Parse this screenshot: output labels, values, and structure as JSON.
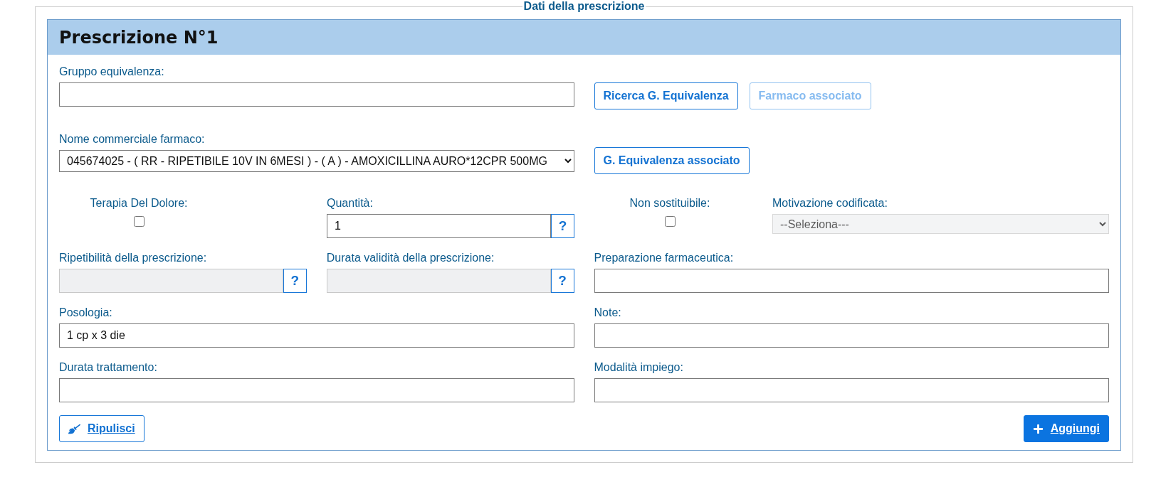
{
  "legend": "Dati della prescrizione",
  "panel_title": "Prescrizione N°1",
  "gruppo_equivalenza": {
    "label": "Gruppo equivalenza:",
    "disabled": false
  },
  "gruppo_buttons": [
    {
      "label": "Ricerca G. Equivalenza",
      "disabled": false
    },
    {
      "label": "Farmaco associato",
      "disabled": true
    }
  ],
  "nome_commerciale": {
    "label": "Nome commerciale farmaco:",
    "value": "045674025 - ( RR - RIPETIBILE 10V IN 6MESI ) - ( A ) - AMOXICILLINA AURO*12CPR 500MG",
    "disabled": false
  },
  "nome_buttons": [
    {
      "label": "G. Equivalenza associato",
      "disabled": false
    }
  ],
  "terapia_del_dolore": {
    "label": "Terapia Del Dolore:",
    "checked": false
  },
  "quantita": {
    "label": "Quantità:",
    "value": "1",
    "help": "?",
    "disabled": false
  },
  "non_sostituibile": {
    "label": "Non sostituibile:",
    "checked": false
  },
  "motivazione_codificata": {
    "label": "Motivazione codificata:",
    "value": "--Seleziona---",
    "disabled": true
  },
  "ripetibilita": {
    "label": "Ripetibilità della prescrizione:",
    "help": "?",
    "disabled": true
  },
  "durata_validita": {
    "label": "Durata validità della prescrizione:",
    "help": "?",
    "disabled": true
  },
  "preparazione_farmaceutica": {
    "label": "Preparazione farmaceutica:",
    "disabled": false
  },
  "posologia": {
    "label": "Posologia:",
    "value": "1 cp x 3 die",
    "disabled": false
  },
  "note": {
    "label": "Note:",
    "disabled": false
  },
  "durata_trattamento": {
    "label": "Durata trattamento:",
    "disabled": false
  },
  "modalita_impiego": {
    "label": "Modalità impiego:",
    "disabled": false
  },
  "actions": [
    {
      "kind": "clear",
      "label": "Ripulisci"
    },
    {
      "kind": "add",
      "label": "Aggiungi"
    }
  ]
}
